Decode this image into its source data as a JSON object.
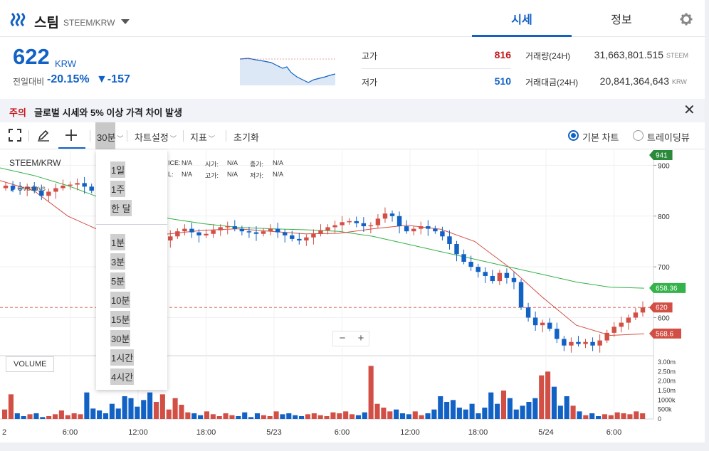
{
  "header": {
    "coin_name": "스팀",
    "coin_pair": "STEEM/KRW",
    "tabs": [
      {
        "label": "시세"
      },
      {
        "label": "정보"
      }
    ]
  },
  "price": {
    "current": "622",
    "unit": "KRW",
    "change_label": "전일대비",
    "change_rate": "-20.15%",
    "change_amount": "▼-157"
  },
  "stats": {
    "high_label": "고가",
    "high_value": "816",
    "low_label": "저가",
    "low_value": "510",
    "volume_label": "거래량(24H)",
    "volume_value": "31,663,801.515",
    "volume_unit": "STEEM",
    "amount_label": "거래대금(24H)",
    "amount_value": "20,841,364,643",
    "amount_unit": "KRW"
  },
  "notice": {
    "tag": "주의",
    "message": "글로벌 시세와 5% 이상 가격 차이 발생",
    "close": "✕"
  },
  "toolbar": {
    "interval": "30분",
    "chart_settings": "차트설정",
    "indicators": "지표",
    "reset": "초기화",
    "basic_chart": "기본 차트",
    "tradingview": "트레이딩뷰"
  },
  "legend": {
    "symbol": "STEEM/KRW",
    "overlays": "Overlays",
    "row1": [
      {
        "label": "ICE:",
        "value": "N/A"
      },
      {
        "label": "시가:",
        "value": "N/A"
      },
      {
        "label": "종가:",
        "value": "N/A"
      }
    ],
    "row2": [
      {
        "label": "L:",
        "value": "N/A"
      },
      {
        "label": "고가:",
        "value": "N/A"
      },
      {
        "label": "저가:",
        "value": "N/A"
      }
    ]
  },
  "interval_menu": {
    "group1": [
      "1일",
      "1주",
      "한 달"
    ],
    "group2": [
      "1분",
      "3분",
      "5분",
      "10분",
      "15분",
      "30분",
      "1시간",
      "4시간"
    ]
  },
  "volume_button": "VOLUME",
  "zoom": {
    "minus": "−",
    "plus": "+"
  },
  "colors": {
    "accent": "#1261c4",
    "up": "#d24f45",
    "down": "#1261c4",
    "ma_short": "#d24f45",
    "ma_long": "#33b349",
    "alert": "#c2181b"
  },
  "chart_data": {
    "type": "candlestick",
    "price_axis": {
      "ticks": [
        "900",
        "800",
        "700",
        "600"
      ],
      "range": [
        525,
        930
      ]
    },
    "volume_axis": {
      "ticks": [
        "3.00m",
        "2.50m",
        "2.00m",
        "1.50m",
        "1000k",
        "500k",
        "0"
      ],
      "range": [
        0,
        3000000
      ]
    },
    "x_ticks": [
      "2",
      "6:00",
      "12:00",
      "18:00",
      "5/23",
      "6:00",
      "12:00",
      "18:00",
      "5/24",
      "6:00"
    ],
    "price_tags": [
      {
        "label": "941",
        "value": 941,
        "color": "#2a8a3a"
      },
      {
        "label": "658.36",
        "value": 658.36,
        "color": "#33b349"
      },
      {
        "label": "620",
        "value": 620,
        "color": "#d24f45"
      },
      {
        "label": "568.6",
        "value": 568.6,
        "color": "#d24f45"
      }
    ],
    "last_price": 620,
    "closes": [
      860,
      855,
      853,
      858,
      850,
      840,
      848,
      855,
      860,
      862,
      865,
      858,
      850,
      840,
      830,
      810,
      790,
      770,
      755,
      745,
      740,
      745,
      752,
      760,
      770,
      775,
      768,
      762,
      765,
      772,
      778,
      780,
      775,
      770,
      768,
      765,
      770,
      775,
      768,
      762,
      755,
      752,
      758,
      765,
      772,
      778,
      782,
      788,
      790,
      786,
      780,
      782,
      795,
      805,
      800,
      780,
      770,
      775,
      780,
      775,
      770,
      760,
      745,
      725,
      710,
      700,
      690,
      682,
      672,
      688,
      678,
      670,
      620,
      600,
      585,
      590,
      578,
      558,
      545,
      552,
      548,
      552,
      545,
      555,
      570,
      582,
      590,
      600,
      610,
      620
    ],
    "ma_short": [
      870,
      850,
      800,
      770,
      761,
      765,
      772,
      775,
      770,
      765,
      766,
      775,
      782,
      774,
      750,
      700,
      640,
      585,
      565,
      568
    ],
    "ma_long": [
      895,
      880,
      860,
      835,
      810,
      795,
      785,
      778,
      775,
      773,
      770,
      760,
      745,
      730,
      715,
      700,
      685,
      670,
      660,
      658
    ],
    "volumes": [
      500000,
      1300000,
      300000,
      150000,
      250000,
      300000,
      100000,
      150000,
      250000,
      450000,
      200000,
      300000,
      250000,
      1400000,
      550000,
      450000,
      300000,
      800000,
      550000,
      1200000,
      1100000,
      650000,
      1000000,
      1400000,
      900000,
      1300000,
      500000,
      1100000,
      750000,
      350000,
      300000,
      200000,
      400000,
      250000,
      150000,
      300000,
      200000,
      150000,
      350000,
      100000,
      300000,
      200000,
      150000,
      400000,
      250000,
      300000,
      200000,
      150000,
      250000,
      300000,
      200000,
      150000,
      350000,
      300000,
      400000,
      250000,
      200000,
      350000,
      2800000,
      800000,
      600000,
      400000,
      500000,
      300000,
      250000,
      400000,
      200000,
      300000,
      500000,
      1200000,
      900000,
      1000000,
      600000,
      500000,
      800000,
      300000,
      600000,
      1400000,
      800000,
      1500000,
      1100000,
      500000,
      700000,
      900000,
      1100000,
      2300000,
      2500000,
      1700000,
      700000,
      1200000,
      700000,
      400000,
      200000,
      300000,
      150000,
      250000,
      200000,
      350000,
      300000,
      250000,
      400000,
      300000
    ]
  }
}
